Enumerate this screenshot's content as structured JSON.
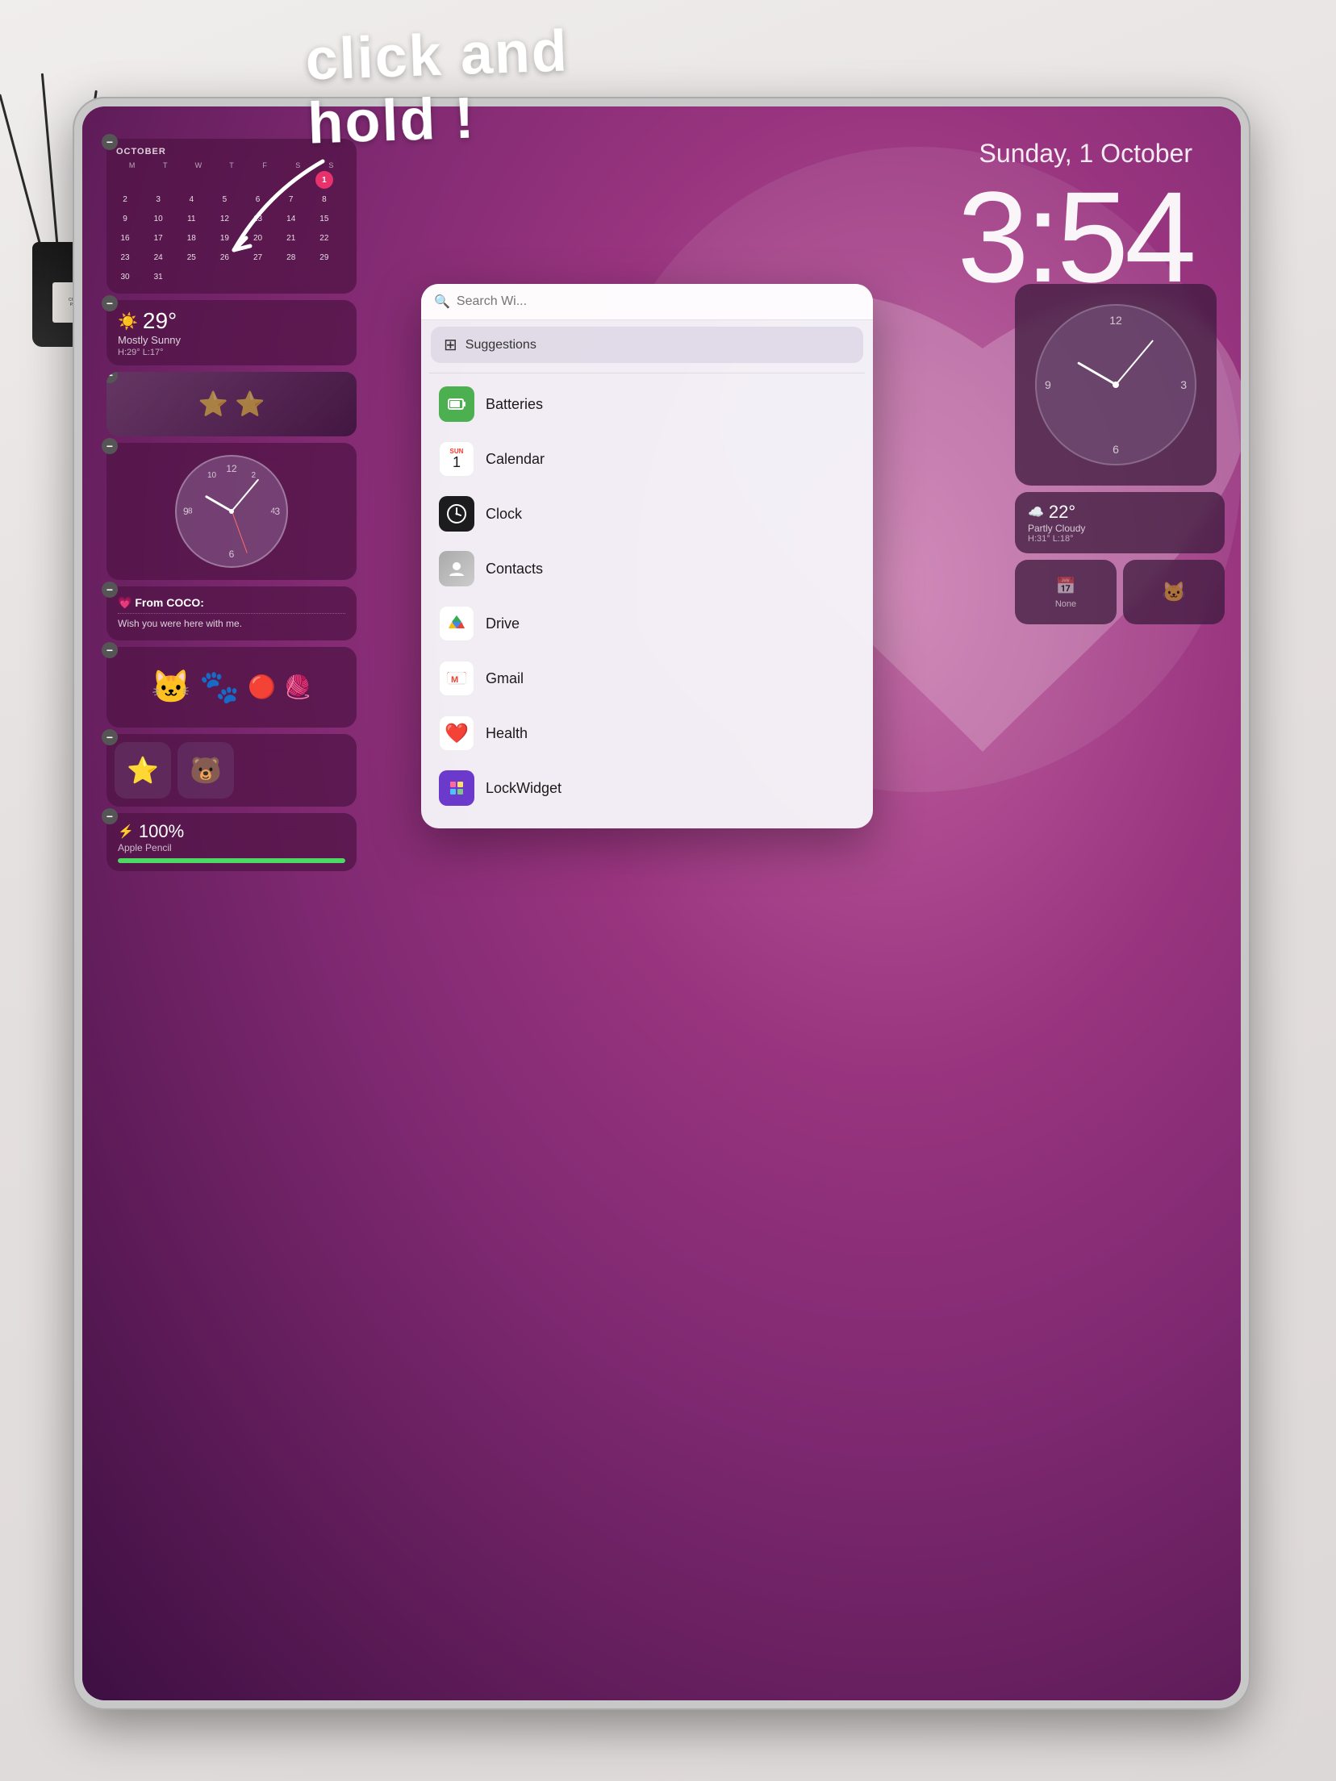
{
  "annotation": {
    "line1": "click and",
    "line2": "hold !"
  },
  "ipad": {
    "date": "Sunday, 1 October",
    "time": "3:54"
  },
  "calendar_widget": {
    "month": "OCTOBER",
    "headers": [
      "M",
      "T",
      "W",
      "T",
      "F",
      "S",
      "S"
    ],
    "days": [
      {
        "n": "",
        "empty": true
      },
      {
        "n": "",
        "empty": true
      },
      {
        "n": "",
        "empty": true
      },
      {
        "n": "",
        "empty": true
      },
      {
        "n": "",
        "empty": true
      },
      {
        "n": "",
        "empty": true
      },
      {
        "n": "1",
        "today": true
      },
      {
        "n": "2"
      },
      {
        "n": "3"
      },
      {
        "n": "4"
      },
      {
        "n": "5"
      },
      {
        "n": "6"
      },
      {
        "n": "7"
      },
      {
        "n": "8"
      },
      {
        "n": "9"
      },
      {
        "n": "10"
      },
      {
        "n": "11"
      },
      {
        "n": "12"
      },
      {
        "n": "13"
      },
      {
        "n": "14"
      },
      {
        "n": "15"
      },
      {
        "n": "16"
      },
      {
        "n": "17"
      },
      {
        "n": "18"
      },
      {
        "n": "19"
      },
      {
        "n": "20"
      },
      {
        "n": "21"
      },
      {
        "n": "22"
      },
      {
        "n": "23"
      },
      {
        "n": "24"
      },
      {
        "n": "25"
      },
      {
        "n": "26"
      },
      {
        "n": "27"
      },
      {
        "n": "28"
      },
      {
        "n": "29"
      },
      {
        "n": "30"
      },
      {
        "n": "31"
      }
    ]
  },
  "weather_widget": {
    "icon": "☀️",
    "temperature": "29°",
    "description": "Mostly Sunny",
    "range": "H:29° L:17°"
  },
  "clock_widget": {
    "label": "Clock"
  },
  "memo_widget": {
    "title": "💗 From COCO:",
    "text": "Wish you were here with me."
  },
  "battery_widget": {
    "icon": "⚡",
    "percentage": "100%",
    "label": "Apple Pencil",
    "fill_width": "100%"
  },
  "widget_picker": {
    "search_placeholder": "Search Wi...",
    "suggestions_label": "Suggestions",
    "items": [
      {
        "name": "Batteries",
        "icon_color": "#4CAF50",
        "icon": "🔋"
      },
      {
        "name": "Calendar",
        "icon_color": "#FF3B30",
        "icon": "📅"
      },
      {
        "name": "Clock",
        "icon_color": "#1C1C1E",
        "icon": "🕐"
      },
      {
        "name": "Contacts",
        "icon_color": "#888",
        "icon": "👤"
      },
      {
        "name": "Drive",
        "icon_color": "#FFF",
        "icon": "△"
      },
      {
        "name": "Gmail",
        "icon_color": "#FFF",
        "icon": "M"
      },
      {
        "name": "Health",
        "icon_color": "#FFF",
        "icon": "❤️"
      },
      {
        "name": "LockWidget",
        "icon_color": "#6B39CC",
        "icon": "🔒"
      }
    ]
  },
  "preview_weather": {
    "icon": "☁️",
    "temp": "22°",
    "description": "Partly Cloudy",
    "range": "H:31° L:18°"
  },
  "preview_none": {
    "label": "None"
  },
  "diffuser": {
    "label1": "CHARM SER",
    "label2": "PARIS CHA"
  }
}
